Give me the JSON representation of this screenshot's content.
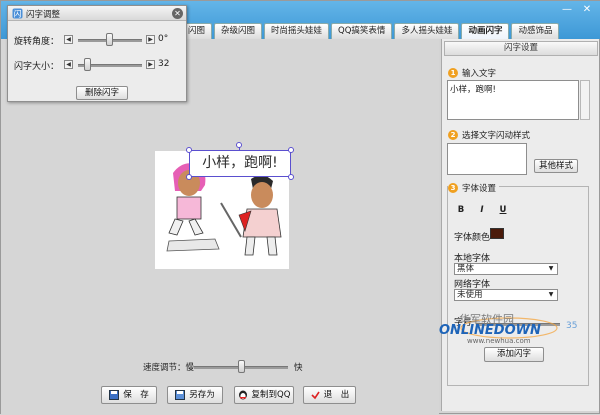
{
  "tabs": [
    "闪图",
    "杂级闪图",
    "时尚摇头娃娃",
    "QQ搞笑表情",
    "多人摇头娃娃",
    "动画闪字",
    "动感饰品"
  ],
  "active_tab": "动画闪字",
  "dialog": {
    "title": "闪字调整",
    "rotate_label": "旋转角度：",
    "rotate_value": "0°",
    "size_label": "闪字大小：",
    "size_value": "32",
    "delete_button": "删除闪字"
  },
  "canvas": {
    "bubble_text": "小样，跑啊!",
    "speed_label": "速度调节：慢",
    "speed_fast": "快",
    "speed_level": 0.5
  },
  "bottom_buttons": {
    "save": "保　存",
    "save_as": "另存为",
    "copy_qq": "复制到QQ",
    "exit": "退　出"
  },
  "panel": {
    "header": "闪字设置",
    "input_label": "输入文字",
    "input_value": "小样，跑啊!",
    "style_label": "选择文字闪动样式",
    "other_style_button": "其他样式",
    "font_settings_label": "字体设置",
    "bold": "B",
    "italic": "I",
    "underline": "U",
    "font_color_label": "字体颜色",
    "font_color": "#4a1a0a",
    "local_font_label": "本地字体",
    "local_font_value": "黑体",
    "web_font_label": "网络字体",
    "web_font_value": "未使用",
    "font_size_label": "字号",
    "font_size_value": "35",
    "add_button": "添加闪字"
  },
  "watermark": {
    "cn": "华军软件园",
    "en": "ONLINEDOWN",
    "url": "www.newhua.com"
  },
  "colors": {
    "accent": "#3d98d6",
    "selection": "#5a4fcf",
    "badge": "#f0a020"
  }
}
